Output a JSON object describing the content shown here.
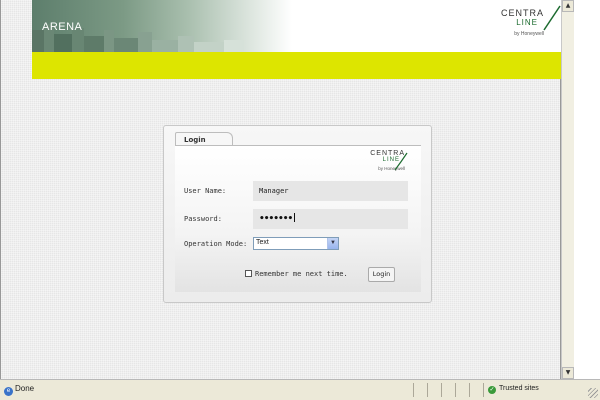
{
  "header": {
    "app_name": "ARENA",
    "brand_top": "CENTRA",
    "brand_line": "LINE",
    "brand_by": "by Honeywell"
  },
  "login": {
    "tab_label": "Login",
    "brand_top": "CENTRA",
    "brand_line": "LINE",
    "brand_by": "by Honeywell",
    "username_label": "User Name:",
    "username_value": "Manager",
    "password_label": "Password:",
    "password_mask": "•••••••",
    "opmode_label": "Operation Mode:",
    "opmode_selected": "Text",
    "remember_label": "Remember me next time.",
    "remember_checked": false,
    "login_button": "Login"
  },
  "statusbar": {
    "status_text": "Done",
    "zone_text": "Trusted sites"
  },
  "colors": {
    "accent_yellow": "#dde500",
    "brand_green": "#1c6b2f",
    "page_bg": "#e6e6e6"
  }
}
